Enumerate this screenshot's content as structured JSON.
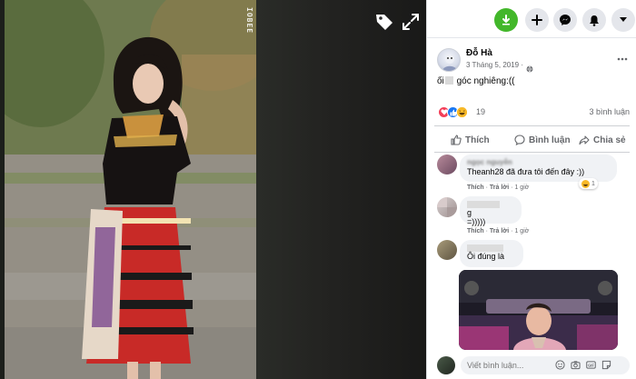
{
  "viewer": {
    "watermark": "IOBEE",
    "tag_icon": "tag-icon",
    "fullscreen_icon": "fullscreen-icon"
  },
  "topbar": {
    "icons": [
      "download-icon",
      "plus-icon",
      "messenger-icon",
      "notifications-bell-icon",
      "account-caret-icon"
    ],
    "download_color": "#42b72a"
  },
  "post": {
    "author": "Đỗ Hà",
    "date": "3 Tháng 5, 2019 ·",
    "text_before": "ối",
    "text_after": "góc nghiêng:((",
    "reaction_count": "19",
    "comment_count": "3 bình luận",
    "reactions": [
      "love-icon",
      "like-icon",
      "haha-icon"
    ]
  },
  "actions": {
    "like": "Thích",
    "comment": "Bình luận",
    "share": "Chia sẻ"
  },
  "comments": [
    {
      "name": "ngọc nguyễn",
      "text": "Theanh28 đã đưa tôi đến đây :))",
      "like": "Thích",
      "reply": "Trả lời",
      "time": "1 giờ",
      "reaction_count": "1"
    },
    {
      "text_prefix": "g",
      "text": "=)))))",
      "like": "Thích",
      "reply": "Trả lời",
      "time": "1 giờ"
    },
    {
      "text": "Ôi đúng là"
    }
  ],
  "composer": {
    "placeholder": "Viết bình luận...",
    "icons": [
      "emoji-icon",
      "camera-icon",
      "gif-icon",
      "sticker-icon"
    ]
  },
  "colors": {
    "brand_blue": "#1877f2",
    "love_red": "#f33e58",
    "haha_yellow": "#f7b928"
  }
}
